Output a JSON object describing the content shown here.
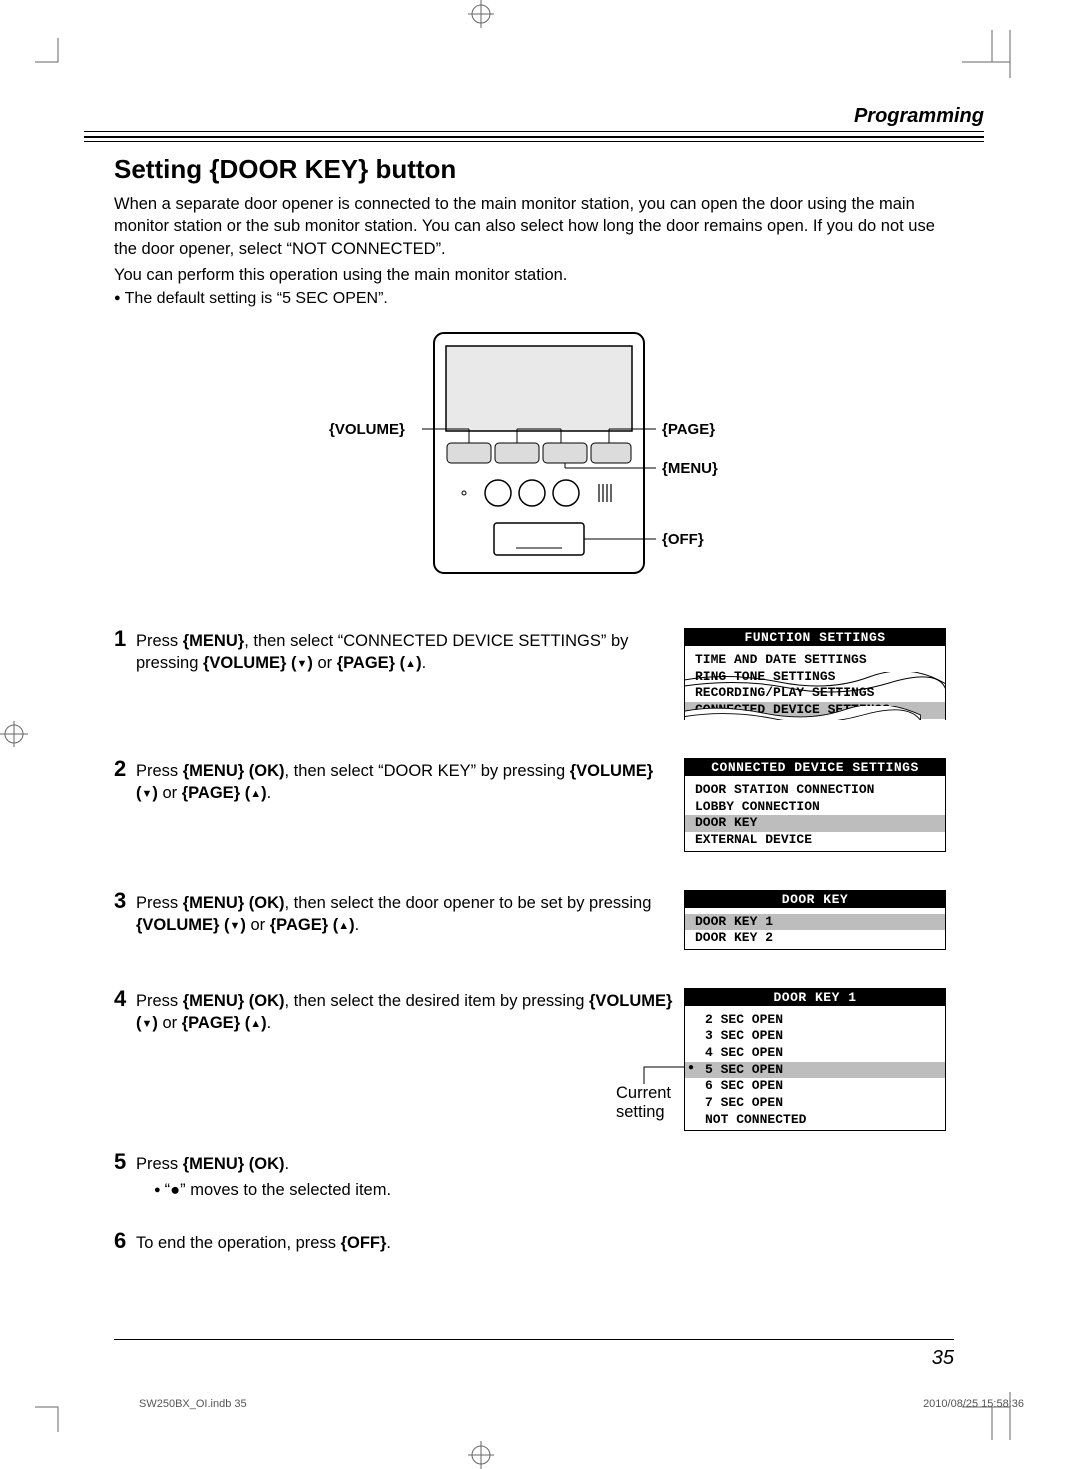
{
  "header": {
    "section": "Programming"
  },
  "title": "Setting {DOOR KEY} button",
  "intro": {
    "p1": "When a separate door opener is connected to the main monitor station, you can open the door using the main monitor station or the sub monitor station. You can also select how long the door remains open. If you do not use the door opener, select “NOT CONNECTED”.",
    "p2": "You can perform this operation using the main monitor station.",
    "note": "The default setting is “5 SEC OPEN”."
  },
  "device_labels": {
    "volume": "{VOLUME}",
    "page": "{PAGE}",
    "menu": "{MENU}",
    "off": "{OFF}"
  },
  "steps": {
    "s1": {
      "num": "1",
      "pre": "Press ",
      "k1": "{MENU}",
      "mid1": ", then select “CONNECTED DEVICE SETTINGS” by pressing ",
      "k2": "{VOLUME} (",
      "k2b": ")",
      "or": " or ",
      "k3": "{PAGE} (",
      "k3b": ")",
      "end": "."
    },
    "s2": {
      "num": "2",
      "pre": "Press ",
      "k1": "{MENU} (OK)",
      "mid1": ", then select “DOOR KEY” by pressing ",
      "k2": "{VOLUME} (",
      "k2b": ")",
      "or": " or ",
      "k3": "{PAGE} (",
      "k3b": ")",
      "end": "."
    },
    "s3": {
      "num": "3",
      "pre": "Press ",
      "k1": "{MENU} (OK)",
      "mid1": ", then select the door opener to be set by pressing ",
      "k2": "{VOLUME} (",
      "k2b": ")",
      "or": " or ",
      "k3": "{PAGE} (",
      "k3b": ")",
      "end": "."
    },
    "s4": {
      "num": "4",
      "pre": "Press ",
      "k1": "{MENU} (OK)",
      "mid1": ", then select the desired item by pressing ",
      "k2": "{VOLUME} (",
      "k2b": ")",
      "or": " or ",
      "k3": "{PAGE} (",
      "k3b": ")",
      "end": "."
    },
    "s5": {
      "num": "5",
      "pre": "Press ",
      "k1": "{MENU} (OK)",
      "end": ".",
      "sub": "“●” moves to the selected item."
    },
    "s6": {
      "num": "6",
      "pre": "To end the operation, press ",
      "k1": "{OFF}",
      "end": "."
    }
  },
  "screens": {
    "s1": {
      "title": "FUNCTION SETTINGS",
      "r1": "TIME AND DATE SETTINGS",
      "r2": "RING TONE SETTINGS",
      "r3": "RECORDING/PLAY SETTINGS",
      "r4": "CONNECTED DEVICE SETTINGS"
    },
    "s2": {
      "title": "CONNECTED DEVICE SETTINGS",
      "r1": "DOOR STATION CONNECTION",
      "r2": "LOBBY CONNECTION",
      "r3": "DOOR KEY",
      "r4": "EXTERNAL DEVICE"
    },
    "s3": {
      "title": "DOOR KEY",
      "r1": "DOOR KEY 1",
      "r2": "DOOR KEY 2"
    },
    "s4": {
      "title": "DOOR KEY 1",
      "r1": "2 SEC OPEN",
      "r2": "3 SEC OPEN",
      "r3": "4 SEC OPEN",
      "r4": "5 SEC OPEN",
      "r5": "6 SEC OPEN",
      "r6": "7 SEC OPEN",
      "r7": "NOT CONNECTED"
    },
    "current_setting_label": "Current\nsetting"
  },
  "page_number": "35",
  "footer": {
    "left": "SW250BX_OI.indb   35",
    "right": "2010/08/25   15:58:36"
  }
}
